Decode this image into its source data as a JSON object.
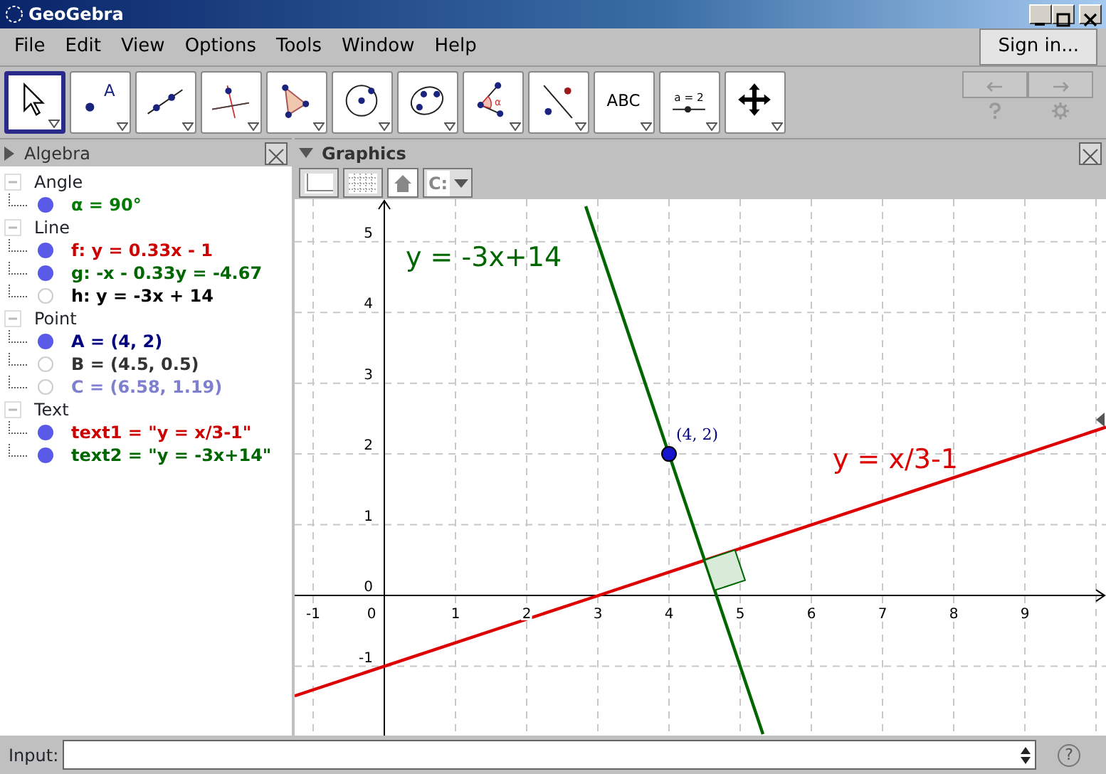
{
  "window": {
    "title": "GeoGebra"
  },
  "menu": [
    "File",
    "Edit",
    "View",
    "Options",
    "Tools",
    "Window",
    "Help"
  ],
  "sign_in": "Sign in...",
  "tools": [
    {
      "kind": "move",
      "selected": true
    },
    {
      "kind": "point",
      "label": "A",
      "selected": false
    },
    {
      "kind": "line",
      "selected": false
    },
    {
      "kind": "perpendicular",
      "selected": false
    },
    {
      "kind": "polygon",
      "selected": false
    },
    {
      "kind": "circle",
      "selected": false
    },
    {
      "kind": "conic",
      "selected": false
    },
    {
      "kind": "angle",
      "label": "α",
      "selected": false
    },
    {
      "kind": "reflect",
      "selected": false
    },
    {
      "kind": "text",
      "label": "ABC",
      "selected": false
    },
    {
      "kind": "slider",
      "label": "a = 2",
      "selected": false
    },
    {
      "kind": "move_view",
      "selected": false
    }
  ],
  "undo": {
    "disabled": true
  },
  "redo": {
    "disabled": true
  },
  "algebra": {
    "title": "Algebra",
    "expanded": false,
    "groups": [
      {
        "label": "Angle",
        "expanded": true,
        "children": [
          {
            "text": "α = 90°",
            "shown": true,
            "color": "#007a00"
          }
        ]
      },
      {
        "label": "Line",
        "expanded": true,
        "children": [
          {
            "text": "f: y = 0.33x - 1",
            "shown": true,
            "color": "#cc0000"
          },
          {
            "text": "g: -x - 0.33y = -4.67",
            "shown": true,
            "color": "#006600"
          },
          {
            "text": "h: y = -3x + 14",
            "shown": false,
            "color": "#000000"
          }
        ]
      },
      {
        "label": "Point",
        "expanded": true,
        "children": [
          {
            "text": "A = (4, 2)",
            "shown": true,
            "color": "#00007f"
          },
          {
            "text": "B = (4.5, 0.5)",
            "shown": false,
            "color": "#333333"
          },
          {
            "text": "C = (6.58, 1.19)",
            "shown": false,
            "color": "#7f7fd0"
          }
        ]
      },
      {
        "label": "Text",
        "expanded": true,
        "children": [
          {
            "text": "text1 = \"y = x/3-1\"",
            "shown": true,
            "color": "#cc0000"
          },
          {
            "text": "text2 = \"y = -3x+14\"",
            "shown": true,
            "color": "#006600"
          }
        ]
      }
    ]
  },
  "graphics": {
    "title": "Graphics",
    "expanded": true,
    "point_capture": "C:",
    "chart_data": {
      "type": "line",
      "x": [
        -1.26,
        2.83,
        5.32,
        10.14
      ],
      "series": [
        {
          "color": "#dd0000",
          "values": [
            -1.42,
            -0.06,
            0.77,
            2.38
          ]
        },
        {
          "color": "#006600",
          "values": [
            null,
            5.5,
            -1.96,
            null
          ]
        }
      ],
      "xlim": [
        -1.26,
        10.14
      ],
      "ylim": [
        -1.98,
        5.6
      ],
      "grid": true,
      "xticks": [
        -1,
        0,
        1,
        2,
        3,
        4,
        5,
        6,
        7,
        8,
        9
      ],
      "yticks": [
        -1,
        0,
        1,
        2,
        3,
        4,
        5
      ],
      "annotations": [
        "y = -3x+14",
        "y = x/3-1",
        "(4, 2)"
      ]
    }
  },
  "input": {
    "label": "Input:",
    "help": "?"
  }
}
